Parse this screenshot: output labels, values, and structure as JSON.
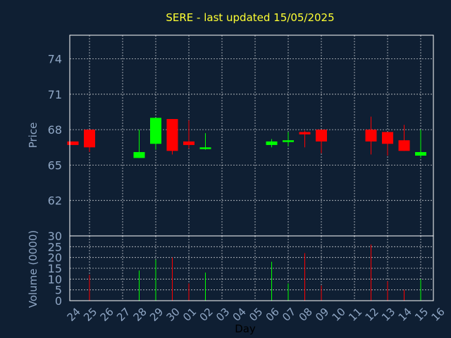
{
  "colors": {
    "background": "#0f1f33",
    "up": "#00ff00",
    "down": "#ff0000",
    "title": "#ffff33",
    "axis_text": "#8fa6c4",
    "grid": "#ffffff"
  },
  "chart_data": {
    "type": "candlestick",
    "title": "SERE - last updated 15/05/2025",
    "xlabel": "Day",
    "price_axis": {
      "ylabel": "Price",
      "ylim": [
        59,
        76
      ],
      "ticks": [
        62,
        65,
        68,
        71,
        74
      ]
    },
    "volume_axis": {
      "ylabel": "Volume (0000)",
      "ylim": [
        0,
        30
      ],
      "ticks": [
        0,
        5,
        10,
        15,
        20,
        25,
        30
      ]
    },
    "x_ticks": [
      "24",
      "25",
      "26",
      "27",
      "28",
      "29",
      "30",
      "01",
      "02",
      "03",
      "04",
      "05",
      "06",
      "07",
      "08",
      "09",
      "10",
      "11",
      "12",
      "13",
      "14",
      "15",
      "16"
    ],
    "grid": true,
    "candles": [
      {
        "x": "24",
        "open": 67.0,
        "close": 66.7,
        "high": 67.0,
        "low": 66.7,
        "volume": 0
      },
      {
        "x": "25",
        "open": 68.0,
        "close": 66.5,
        "high": 68.0,
        "low": 66.1,
        "volume": 12
      },
      {
        "x": "28",
        "open": 65.6,
        "close": 66.1,
        "high": 68.0,
        "low": 65.6,
        "volume": 14
      },
      {
        "x": "29",
        "open": 66.8,
        "close": 69.0,
        "high": 69.0,
        "low": 66.3,
        "volume": 19
      },
      {
        "x": "30",
        "open": 68.9,
        "close": 66.2,
        "high": 68.9,
        "low": 65.9,
        "volume": 20
      },
      {
        "x": "01",
        "open": 67.0,
        "close": 66.7,
        "high": 68.8,
        "low": 66.4,
        "volume": 8
      },
      {
        "x": "02",
        "open": 66.4,
        "close": 66.5,
        "high": 67.7,
        "low": 66.3,
        "volume": 13
      },
      {
        "x": "06",
        "open": 66.7,
        "close": 67.0,
        "high": 67.2,
        "low": 66.5,
        "volume": 18
      },
      {
        "x": "07",
        "open": 67.0,
        "close": 67.1,
        "high": 67.8,
        "low": 66.6,
        "volume": 8
      },
      {
        "x": "08",
        "open": 67.8,
        "close": 67.6,
        "high": 67.9,
        "low": 66.5,
        "volume": 22
      },
      {
        "x": "09",
        "open": 68.0,
        "close": 67.0,
        "high": 68.0,
        "low": 66.0,
        "volume": 7
      },
      {
        "x": "12",
        "open": 68.0,
        "close": 67.0,
        "high": 69.1,
        "low": 65.9,
        "volume": 26
      },
      {
        "x": "13",
        "open": 67.8,
        "close": 66.8,
        "high": 67.8,
        "low": 65.8,
        "volume": 9
      },
      {
        "x": "14",
        "open": 67.1,
        "close": 66.2,
        "high": 68.4,
        "low": 66.2,
        "volume": 5
      },
      {
        "x": "15",
        "open": 65.8,
        "close": 66.1,
        "high": 68.0,
        "low": 65.6,
        "volume": 10
      }
    ]
  }
}
